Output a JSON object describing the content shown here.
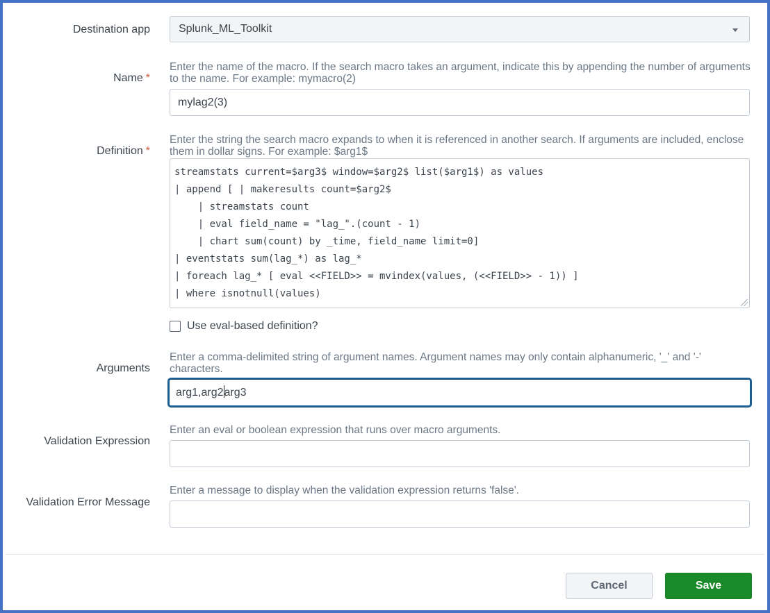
{
  "destination": {
    "label": "Destination app",
    "value": "Splunk_ML_Toolkit"
  },
  "name": {
    "label": "Name",
    "required_mark": "*",
    "help": "Enter the name of the macro. If the search macro takes an argument, indicate this by appending the number of arguments to the name. For example: mymacro(2)",
    "value": "mylag2(3)"
  },
  "definition": {
    "label": "Definition",
    "required_mark": "*",
    "help": "Enter the string the search macro expands to when it is referenced in another search. If arguments are included, enclose them in dollar signs. For example: $arg1$",
    "lines": [
      "streamstats current=$arg3$ window=$arg2$ list($arg1$) as values",
      "| append [ | makeresults count=$arg2$",
      "    | streamstats count",
      "    | eval field_name = \"lag_\".(count - 1)",
      "    | chart sum(count) by _time, field_name limit=0]",
      "| eventstats sum(lag_*) as lag_*",
      "| foreach lag_* [ eval <<FIELD>> = mvindex(values, (<<FIELD>> - 1)) ]",
      "| where isnotnull(values)"
    ]
  },
  "eval_checkbox": {
    "label": "Use eval-based definition?",
    "checked": false
  },
  "arguments": {
    "label": "Arguments",
    "help": "Enter a comma-delimited string of argument names. Argument names may only contain alphanumeric, '_' and '-' characters.",
    "value_before_cursor": "arg1,arg2",
    "value_after_cursor": "arg3"
  },
  "validation_expression": {
    "label": "Validation Expression",
    "help": "Enter an eval or boolean expression that runs over macro arguments.",
    "value": ""
  },
  "validation_error": {
    "label": "Validation Error Message",
    "help": "Enter a message to display when the validation expression returns 'false'.",
    "value": ""
  },
  "buttons": {
    "cancel": "Cancel",
    "save": "Save"
  },
  "colors": {
    "frame": "#4472c4",
    "save": "#1a8929",
    "focus": "#1a5c8f",
    "required": "#d6563c"
  },
  "icons": {
    "dropdown": "chevron-down-icon"
  }
}
